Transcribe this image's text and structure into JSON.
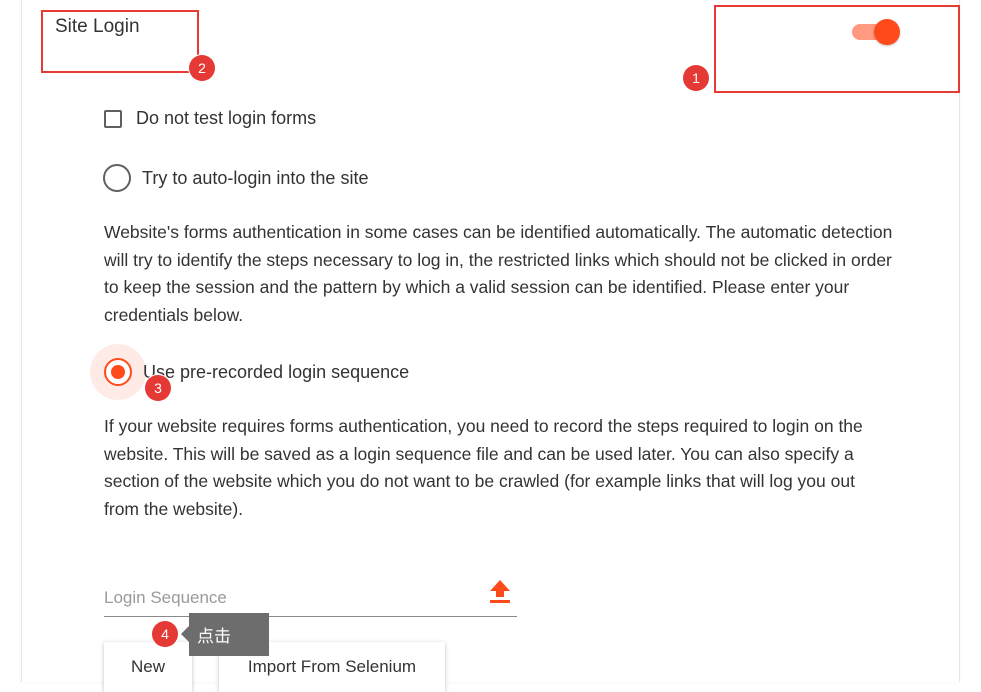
{
  "section": {
    "title": "Site Login"
  },
  "toggle": {
    "state": "on",
    "color": "#ff4a1c"
  },
  "options": {
    "no_test": {
      "label": "Do not test login forms",
      "checked": false
    },
    "auto_login": {
      "label": "Try to auto-login into the site",
      "selected": false
    },
    "auto_login_desc": "Website's forms authentication in some cases can be identified automatically. The automatic detection will try to identify the steps necessary to log in, the restricted links which should not be clicked in order to keep the session and the pattern by which a valid session can be identified. Please enter your credentials below.",
    "prerecorded": {
      "label": "Use pre-recorded login sequence",
      "selected": true
    },
    "prerecorded_desc": "If your website requires forms authentication, you need to record the steps required to login on the website. This will be saved as a login sequence file and can be used later. You can also specify a section of the website which you do not want to be crawled (for example links that will log you out from the website)."
  },
  "login_sequence": {
    "placeholder": "Login Sequence",
    "upload_icon": "upload-icon"
  },
  "buttons": {
    "new": "New",
    "import": "Import From Selenium"
  },
  "annotations": {
    "badge1": "1",
    "badge2": "2",
    "badge3": "3",
    "badge4": "4",
    "tooltip": "点击",
    "color": "#e53935"
  }
}
